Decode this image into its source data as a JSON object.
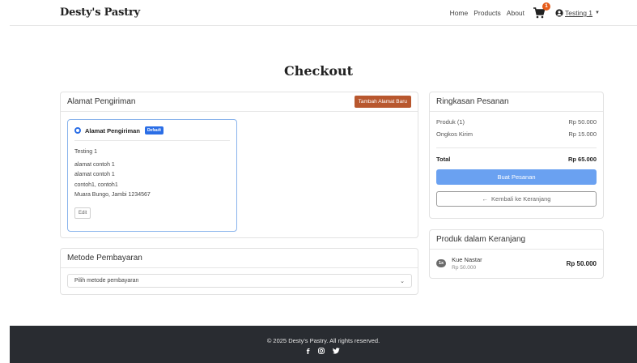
{
  "navbar": {
    "brand": "Desty's Pastry",
    "links": [
      "Home",
      "Products",
      "About"
    ],
    "cart_count": "1",
    "user_name": "Testing 1"
  },
  "page": {
    "title": "Checkout"
  },
  "address_card": {
    "title": "Alamat Pengiriman",
    "add_button": "Tambah Alamat Baru",
    "selected": {
      "label": "Alamat Pengiriman",
      "badge": "Default",
      "name": "Testing 1",
      "line1": "alamat contoh 1",
      "line2": "alamat contoh 1",
      "line3": "contoh1, contoh1",
      "line4": "Muara Bungo, Jambi 1234567",
      "edit": "Edit"
    }
  },
  "payment_card": {
    "title": "Metode Pembayaran",
    "select_placeholder": "Pilih metode pembayaran"
  },
  "summary_card": {
    "title": "Ringkasan Pesanan",
    "product_label": "Produk (1)",
    "product_value": "Rp 50.000",
    "shipping_label": "Ongkos Kirim",
    "shipping_value": "Rp 15.000",
    "total_label": "Total",
    "total_value": "Rp 65.000",
    "order_button": "Buat Pesanan",
    "back_button": "Kembali ke Keranjang"
  },
  "cart_card": {
    "title": "Produk dalam Keranjang",
    "items": [
      {
        "qty": "1x",
        "name": "Kue Nastar",
        "price": "Rp 50.000",
        "total": "Rp 50.000"
      }
    ]
  },
  "footer": {
    "copyright": "© 2025 Desty's Pastry. All rights reserved.",
    "social_icons": [
      "facebook-icon",
      "instagram-icon",
      "twitter-icon"
    ]
  },
  "colors": {
    "accent_brown": "#b8572e",
    "primary_blue": "#6aa1f1",
    "badge_blue": "#2b6ee6",
    "cart_badge": "#e65c1a",
    "footer_bg": "#292c31"
  }
}
